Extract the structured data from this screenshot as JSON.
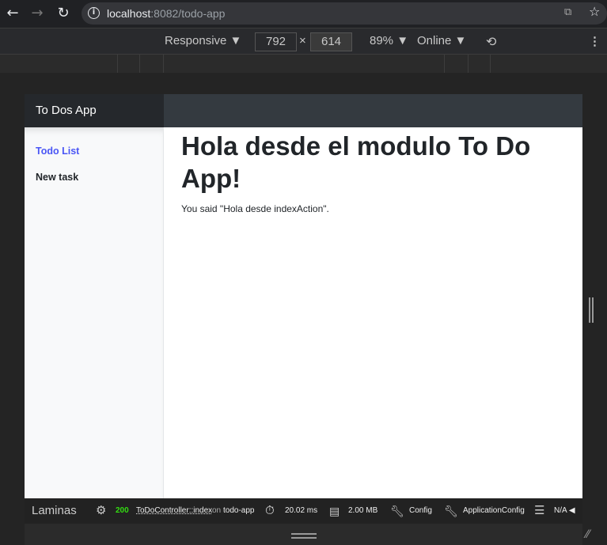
{
  "browser": {
    "url_host": "localhost",
    "url_rest": ":8082/todo-app"
  },
  "devtools": {
    "device": "Responsive",
    "width": "792",
    "height": "614",
    "times": "×",
    "zoom": "89%",
    "network": "Online"
  },
  "app": {
    "brand": "To Dos App",
    "nav": [
      {
        "label": "Todo List",
        "active": true
      },
      {
        "label": "New task",
        "active": false
      }
    ],
    "heading": "Hola desde el modulo To Do App!",
    "message": "You said \"Hola desde indexAction\"."
  },
  "toolbar": {
    "logo": "Laminas",
    "status": "200",
    "controller": "ToDoController::index",
    "on": "on",
    "route": "todo-app",
    "time": "20.02 ms",
    "memory": "2.00 MB",
    "config": "Config",
    "app_config": "ApplicationConfig",
    "db": "N/A ◀"
  },
  "colors": {
    "active_link": "#4a56f5",
    "status_ok": "#33dd11"
  }
}
